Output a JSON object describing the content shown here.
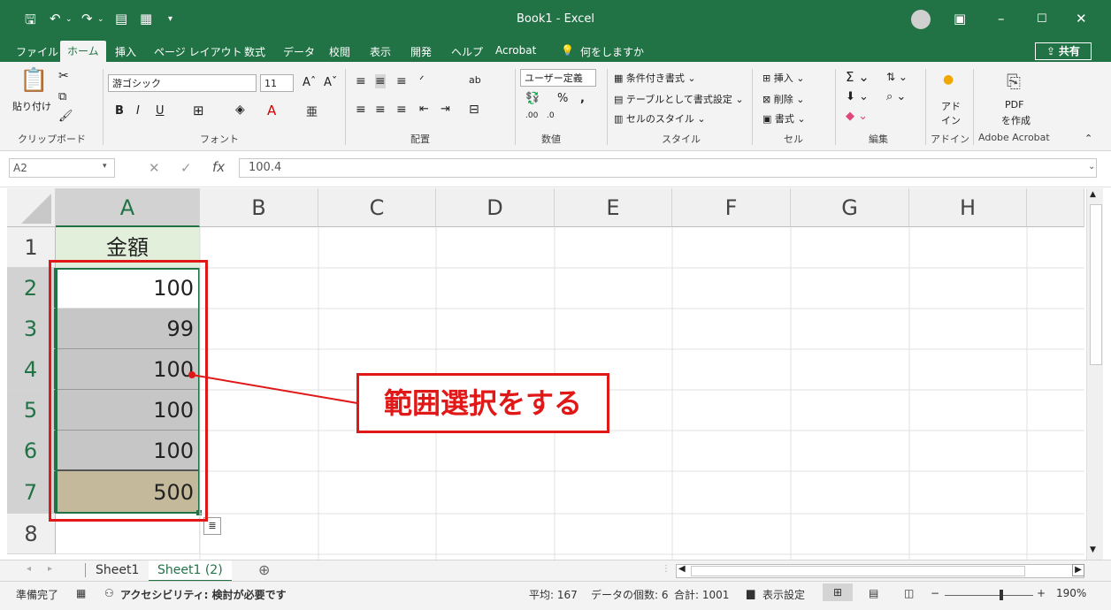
{
  "window": {
    "title": "Book1  -  Excel",
    "controls": {
      "minimize": "–",
      "restore": "☐",
      "close": "✕"
    }
  },
  "menu": {
    "items": [
      "ファイル",
      "ホーム",
      "挿入",
      "ページ レイアウト",
      "数式",
      "データ",
      "校閲",
      "表示",
      "開発",
      "ヘルプ",
      "Acrobat"
    ],
    "search": "何をしますか",
    "share": "共有"
  },
  "ribbon": {
    "clipboard": {
      "paste": "貼り付け",
      "label": "クリップボード"
    },
    "font": {
      "name": "游ゴシック",
      "size": "11",
      "label": "フォント"
    },
    "alignment": {
      "label": "配置"
    },
    "number": {
      "format": "ユーザー定義",
      "percent": "%",
      "comma": ",",
      "label": "数値"
    },
    "styles": {
      "conditional": "条件付き書式",
      "table": "テーブルとして書式設定",
      "cell": "セルのスタイル",
      "label": "スタイル"
    },
    "cells": {
      "insert": "挿入",
      "delete": "削除",
      "format": "書式",
      "label": "セル"
    },
    "editing": {
      "label": "編集"
    },
    "addin": {
      "line1": "アド",
      "line2": "イン",
      "label": "アドイン"
    },
    "acrobat": {
      "line1": "PDF",
      "line2": "を作成",
      "label": "Adobe Acrobat"
    }
  },
  "formula_bar": {
    "name_box": "A2",
    "value": "100.4"
  },
  "grid": {
    "columns": [
      "A",
      "B",
      "C",
      "D",
      "E",
      "F",
      "G",
      "H"
    ],
    "rows": [
      "1",
      "2",
      "3",
      "4",
      "5",
      "6",
      "7",
      "8"
    ],
    "a_values": [
      "金額",
      "100",
      "99",
      "100",
      "100",
      "100",
      "500",
      ""
    ]
  },
  "annotation": {
    "text": "範囲選択をする",
    "color": "#e01818"
  },
  "sheets": {
    "tabs": [
      "Sheet1",
      "Sheet1 (2)"
    ],
    "active": "Sheet1 (2)"
  },
  "status": {
    "ready": "準備完了",
    "accessibility": "アクセシビリティ: 検討が必要です",
    "average": "平均: 167",
    "count": "データの個数: 6",
    "sum": "合計: 1001",
    "display_settings": "表示設定",
    "zoom": "190%"
  },
  "colors": {
    "excel_green": "#217346",
    "highlight": "#e01818"
  }
}
